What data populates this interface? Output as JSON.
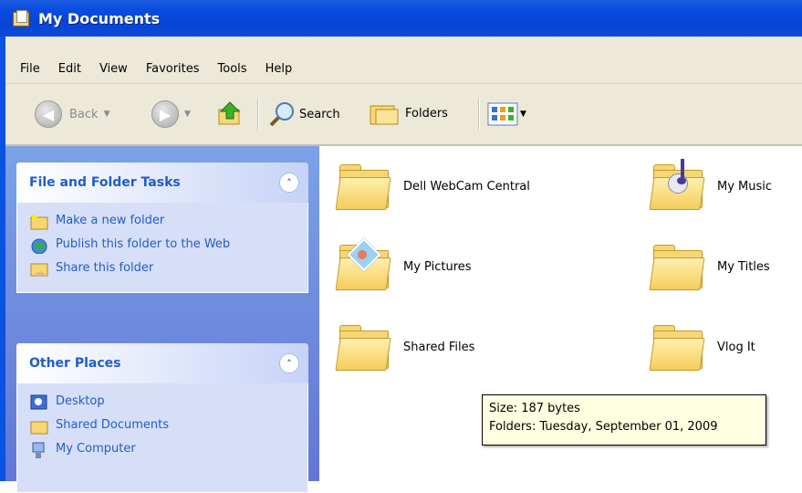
{
  "window": {
    "title": "My Documents"
  },
  "menu": [
    "File",
    "Edit",
    "View",
    "Favorites",
    "Tools",
    "Help"
  ],
  "toolbar": {
    "back_label": "Back",
    "search_label": "Search",
    "folders_label": "Folders"
  },
  "sidebar": {
    "file_tasks": {
      "title": "File and Folder Tasks",
      "items": [
        "Make a new folder",
        "Publish this folder to the Web",
        "Share this folder"
      ]
    },
    "other_places": {
      "title": "Other Places",
      "items": [
        "Desktop",
        "Shared Documents",
        "My Computer"
      ]
    }
  },
  "folders": [
    "Dell WebCam Central",
    "My Music",
    "My Pictures",
    "My Titles",
    "Shared Files",
    "Vlog It"
  ],
  "tooltip": {
    "line1": "Size: 187 bytes",
    "line2": "Folders: Tuesday, September 01, 2009"
  },
  "colors": {
    "titlebar": "#0a4de0",
    "link": "#215dc6",
    "folder": "#f6d774",
    "tooltip_bg": "#ffffe1"
  }
}
